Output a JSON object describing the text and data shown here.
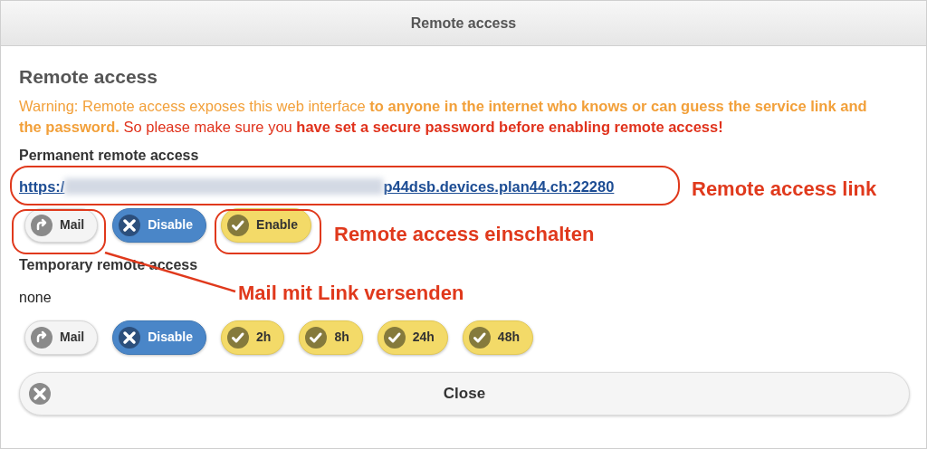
{
  "window": {
    "title": "Remote access"
  },
  "heading": "Remote access",
  "warning": [
    {
      "color": "#f2a03a",
      "text": "Warning: Remote access exposes this web interface **to anyone in the internet who knows or can guess the service link and the password.**"
    },
    {
      "color": "#e0321c",
      "text": "So please make sure you **have set a secure password before enabling remote access!**"
    }
  ],
  "permanent": {
    "label": "Permanent remote access",
    "link_start": "https:/",
    "link_end": "p44dsb.devices.plan44.ch:22280",
    "buttons": [
      {
        "kind": "mail",
        "label": "Mail"
      },
      {
        "kind": "disable",
        "label": "Disable"
      },
      {
        "kind": "enable",
        "label": "Enable"
      }
    ]
  },
  "temporary": {
    "label": "Temporary remote access",
    "value": "none",
    "buttons": [
      {
        "kind": "mail",
        "label": "Mail"
      },
      {
        "kind": "disable",
        "label": "Disable"
      },
      {
        "kind": "enable",
        "label": "2h"
      },
      {
        "kind": "enable",
        "label": "8h"
      },
      {
        "kind": "enable",
        "label": "24h"
      },
      {
        "kind": "enable",
        "label": "48h"
      }
    ]
  },
  "close_button": {
    "label": "Close"
  },
  "annotations": [
    {
      "text": "Remote access link"
    },
    {
      "text": "Remote access einschalten"
    },
    {
      "text": "Mail mit Link versenden"
    }
  ]
}
